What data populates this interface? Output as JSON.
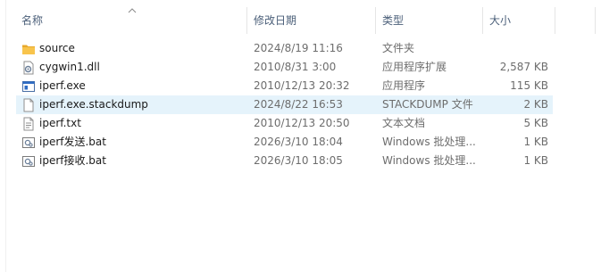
{
  "columns": {
    "name": "名称",
    "date": "修改日期",
    "type": "类型",
    "size": "大小"
  },
  "sort": {
    "column": "name",
    "direction": "ascending",
    "icon": "sort-up-arrow-icon"
  },
  "colors": {
    "header_text": "#4c607a",
    "selected_row": "#e5f3fb",
    "folder": "#f8c44c",
    "secondary_text": "#6d6d6d"
  },
  "files": [
    {
      "name": "source",
      "date": "2024/8/19 11:16",
      "type": "文件夹",
      "size": "",
      "icon": "folder-icon",
      "selected": false
    },
    {
      "name": "cygwin1.dll",
      "date": "2010/8/31 3:00",
      "type": "应用程序扩展",
      "size": "2,587 KB",
      "icon": "dll-file-icon",
      "selected": false
    },
    {
      "name": "iperf.exe",
      "date": "2010/12/13 20:32",
      "type": "应用程序",
      "size": "115 KB",
      "icon": "exe-file-icon",
      "selected": false
    },
    {
      "name": "iperf.exe.stackdump",
      "date": "2024/8/22 16:53",
      "type": "STACKDUMP 文件",
      "size": "2 KB",
      "icon": "generic-file-icon",
      "selected": true
    },
    {
      "name": "iperf.txt",
      "date": "2010/12/13 20:50",
      "type": "文本文档",
      "size": "5 KB",
      "icon": "text-file-icon",
      "selected": false
    },
    {
      "name": "iperf发送.bat",
      "date": "2026/3/10 18:04",
      "type": "Windows 批处理...",
      "size": "1 KB",
      "icon": "batch-file-icon",
      "selected": false
    },
    {
      "name": "iperf接收.bat",
      "date": "2026/3/10 18:05",
      "type": "Windows 批处理...",
      "size": "1 KB",
      "icon": "batch-file-icon",
      "selected": false
    }
  ]
}
